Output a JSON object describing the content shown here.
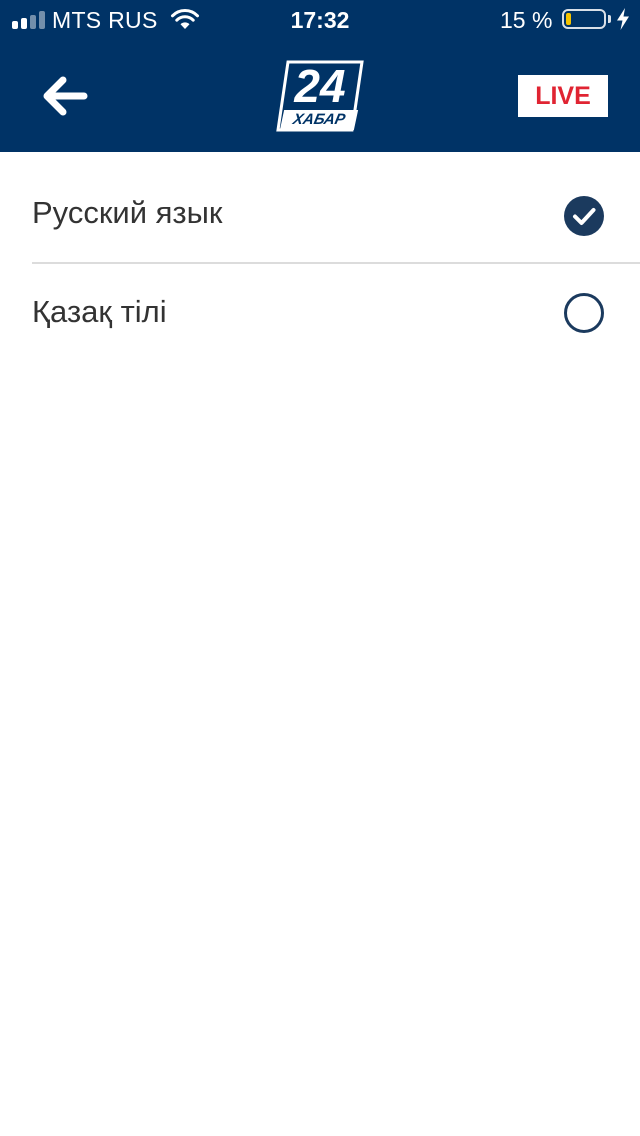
{
  "status_bar": {
    "carrier": "MTS RUS",
    "time": "17:32",
    "battery_percent": "15 %",
    "battery_level": 0.15,
    "signal_bars": 4,
    "signal_active": 2
  },
  "header": {
    "logo": {
      "number": "24",
      "word": "ХАБАР"
    },
    "live_label": "LIVE",
    "colors": {
      "background": "#003366",
      "live_text": "#e02432"
    }
  },
  "languages": [
    {
      "label": "Русский язык",
      "selected": true
    },
    {
      "label": "Қазақ тілі",
      "selected": false
    }
  ],
  "icons": {
    "back": "arrow-left-icon",
    "selected": "check-circle-icon",
    "unselected": "empty-circle-icon"
  }
}
